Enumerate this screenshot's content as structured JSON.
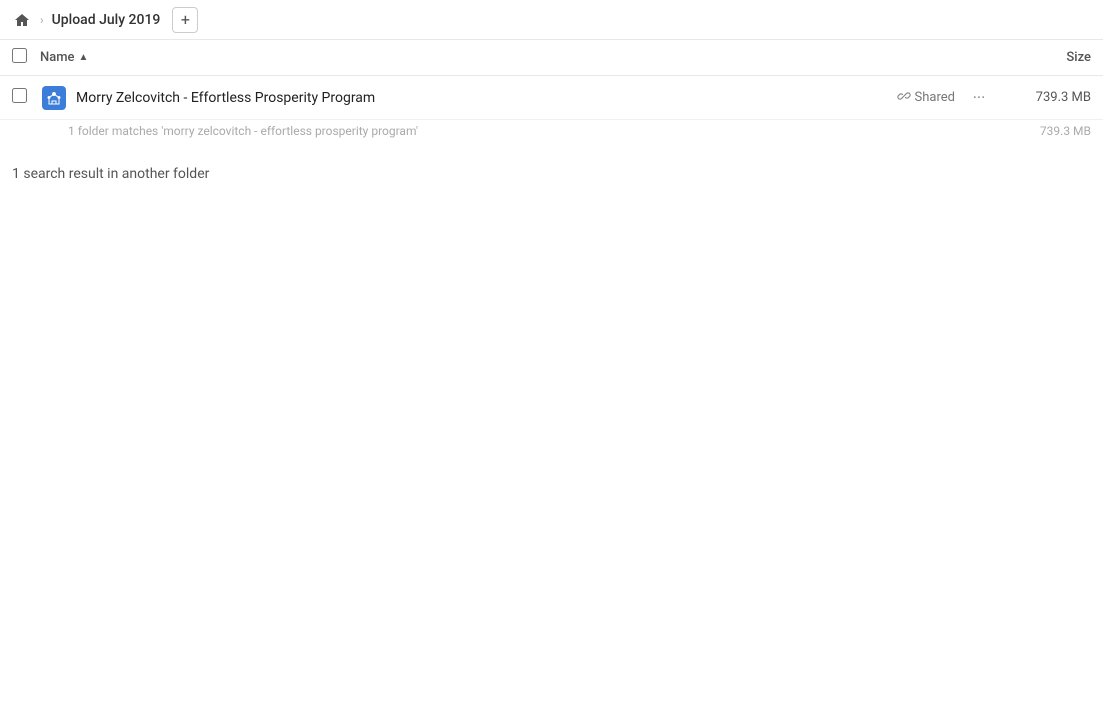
{
  "header": {
    "home_icon": "🏠",
    "breadcrumb_chevron": "›",
    "breadcrumb_label": "Upload July 2019",
    "add_btn_label": "+"
  },
  "columns": {
    "name_label": "Name",
    "sort_arrow": "▲",
    "size_label": "Size"
  },
  "main_result": {
    "folder_icon": "🔗",
    "name": "Morry Zelcovitch - Effortless Prosperity Program",
    "shared_label": "Shared",
    "more_label": "···",
    "size": "739.3 MB",
    "info_text": "1 folder matches 'morry zelcovitch - effortless prosperity program'",
    "info_size": "739.3 MB"
  },
  "other_results": {
    "label": "1 search result in another folder"
  }
}
